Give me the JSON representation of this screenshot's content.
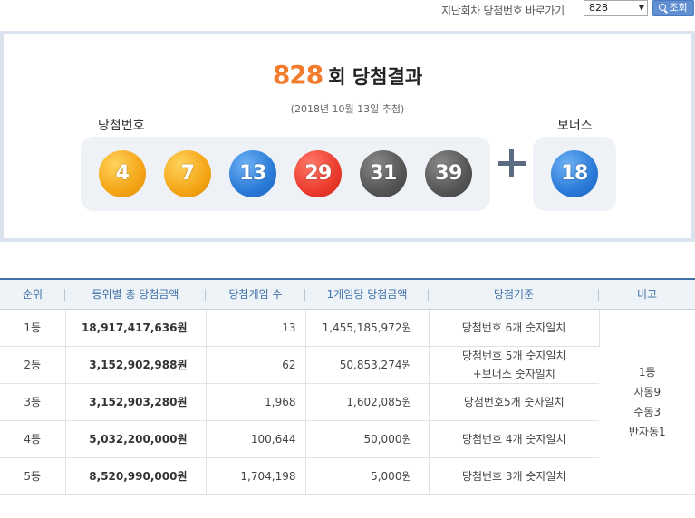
{
  "topbar": {
    "label": "지난회차 당첨번호 바로가기",
    "select_value": "828",
    "search_button": "조회"
  },
  "result": {
    "round": "828",
    "title_suffix": "회 당첨결과",
    "date": "(2018년 10월 13일 추첨)",
    "winning_label": "당첨번호",
    "bonus_label": "보너스",
    "balls": [
      "4",
      "7",
      "13",
      "29",
      "31",
      "39"
    ],
    "bonus": "18"
  },
  "table": {
    "headers": [
      "순위",
      "등위별 총 당첨금액",
      "당첨게임 수",
      "1게임당 당첨금액",
      "당첨기준",
      "비고"
    ],
    "rows": [
      {
        "rank": "1등",
        "total": "18,917,417,636원",
        "count": "13",
        "per": "1,455,185,972원",
        "crit1": "당첨번호 6개 숫자일치",
        "crit2": ""
      },
      {
        "rank": "2등",
        "total": "3,152,902,988원",
        "count": "62",
        "per": "50,853,274원",
        "crit1": "당첨번호 5개 숫자일치",
        "crit2": "+보너스 숫자일치"
      },
      {
        "rank": "3등",
        "total": "3,152,903,280원",
        "count": "1,968",
        "per": "1,602,085원",
        "crit1": "당첨번호5개 숫자일치",
        "crit2": ""
      },
      {
        "rank": "4등",
        "total": "5,032,200,000원",
        "count": "100,644",
        "per": "50,000원",
        "crit1": "당첨번호 4개 숫자일치",
        "crit2": ""
      },
      {
        "rank": "5등",
        "total": "8,520,990,000원",
        "count": "1,704,198",
        "per": "5,000원",
        "crit1": "당첨번호 3개 숫자일치",
        "crit2": ""
      }
    ],
    "note": [
      "1등",
      "자동9",
      "수동3",
      "반자동1"
    ]
  },
  "colors": {
    "round_number": "#f07c2c",
    "header_text": "#3e6fa6",
    "yellow_ball": "#f4a516",
    "blue_ball": "#2a7ad8",
    "red_ball": "#eb3b2d",
    "gray_ball": "#555555"
  }
}
